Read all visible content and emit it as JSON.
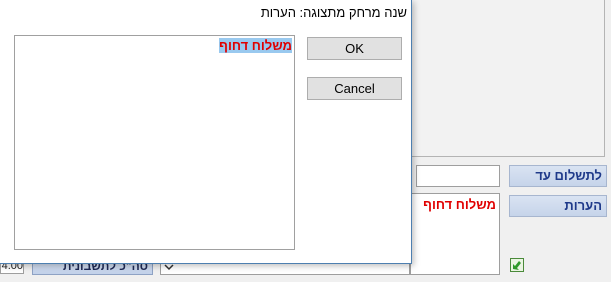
{
  "dialog": {
    "title": "שנה מרחק מתצוגה: הערות",
    "text_value": "משלוח דחוף",
    "ok_label": "OK",
    "cancel_label": "Cancel"
  },
  "background": {
    "payment_until_label": "לתשלום עד",
    "notes_label": "הערות",
    "notes_value": "משלוח דחוף",
    "bottom_button_label": "סה\"כ לתשבונית",
    "amount_value": "4.00"
  },
  "icons": {
    "dropdown": "chevron-down-icon",
    "export": "green-arrow-icon"
  }
}
